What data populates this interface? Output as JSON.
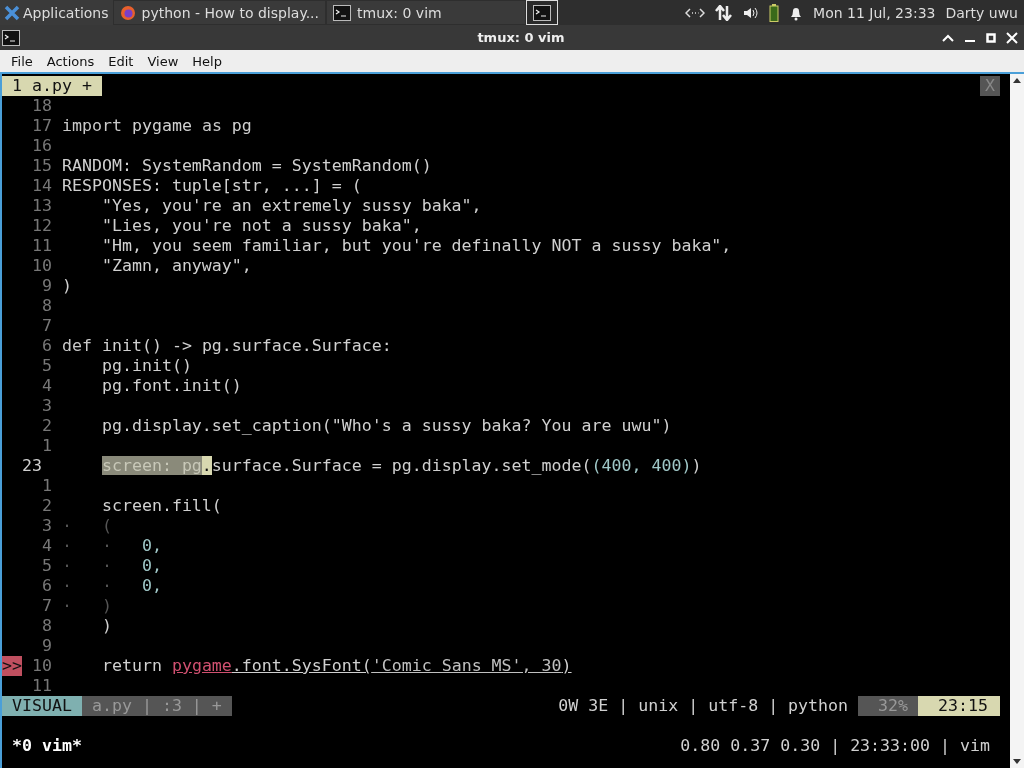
{
  "panel": {
    "menu_label": "Applications",
    "windows": [
      {
        "label": "python - How to display...",
        "kind": "browser",
        "selected": false
      },
      {
        "label": "tmux: 0 vim",
        "kind": "terminal",
        "selected": false
      },
      {
        "kind": "terminal",
        "selected": true
      }
    ],
    "clock": "Mon 11 Jul, 23:33",
    "user": "Darty uwu"
  },
  "window": {
    "title": "tmux: 0 vim"
  },
  "menu": [
    "File",
    "Actions",
    "Edit",
    "View",
    "Help"
  ],
  "vim": {
    "tabline": {
      "tab": "1 a.py +",
      "close": "X"
    },
    "lines": [
      {
        "num": "18"
      },
      {
        "num": "17",
        "segs": [
          {
            "t": "import",
            "kind": "keyword"
          },
          {
            "t": " pygame ",
            "kind": "plain"
          },
          {
            "t": "as",
            "kind": "keyword"
          },
          {
            "t": " pg",
            "kind": "plain"
          }
        ]
      },
      {
        "num": "16"
      },
      {
        "num": "15",
        "segs": [
          {
            "t": "RANDOM: SystemRandom = SystemRandom()",
            "kind": "plain"
          }
        ]
      },
      {
        "num": "14",
        "segs": [
          {
            "t": "RESPONSES: tuple[str, ...] = (",
            "kind": "plain"
          }
        ]
      },
      {
        "num": "13",
        "segs": [
          {
            "t": "    \"Yes, you're an extremely sussy baka\",",
            "kind": "plain"
          }
        ]
      },
      {
        "num": "12",
        "segs": [
          {
            "t": "    \"Lies, you're not a sussy baka\",",
            "kind": "plain"
          }
        ]
      },
      {
        "num": "11",
        "segs": [
          {
            "t": "    \"Hm, you seem familiar, but you're definally NOT a sussy baka\",",
            "kind": "plain"
          }
        ]
      },
      {
        "num": "10",
        "segs": [
          {
            "t": "    \"Zamn, anyway\",",
            "kind": "plain"
          }
        ]
      },
      {
        "num": "9",
        "segs": [
          {
            "t": ")",
            "kind": "plain"
          }
        ]
      },
      {
        "num": "8"
      },
      {
        "num": "7"
      },
      {
        "num": "6",
        "segs": [
          {
            "t": "def",
            "kind": "keyword"
          },
          {
            "t": " init() -> pg.surface.Surface:",
            "kind": "plain"
          }
        ]
      },
      {
        "num": "5",
        "segs": [
          {
            "t": "    pg.init()",
            "kind": "plain"
          }
        ]
      },
      {
        "num": "4",
        "segs": [
          {
            "t": "    pg.font.init()",
            "kind": "plain"
          }
        ]
      },
      {
        "num": "3"
      },
      {
        "num": "2",
        "segs": [
          {
            "t": "    pg.display.set_caption(\"Who's a sussy baka? You are uwu\")",
            "kind": "plain"
          }
        ]
      },
      {
        "num": "1"
      },
      {
        "num": "23",
        "current": true,
        "indented": true,
        "segs": [
          {
            "t": "screen: pg",
            "kind": "visual"
          },
          {
            "t": ".",
            "kind": "cursor"
          },
          {
            "t": "surface.Surface = pg.display.set_mode(",
            "kind": "plain"
          },
          {
            "t": "(400, 400)",
            "kind": "number"
          },
          {
            "t": ")",
            "kind": "plain"
          }
        ]
      },
      {
        "num": "1"
      },
      {
        "num": "2",
        "segs": [
          {
            "t": "    screen.fill(",
            "kind": "plain"
          }
        ]
      },
      {
        "num": "3",
        "segs": [
          {
            "t": "·   (",
            "kind": "dim"
          }
        ]
      },
      {
        "num": "4",
        "segs": [
          {
            "t": "·   ·   ",
            "kind": "dim"
          },
          {
            "t": "0,",
            "kind": "number"
          }
        ]
      },
      {
        "num": "5",
        "segs": [
          {
            "t": "·   ·   ",
            "kind": "dim"
          },
          {
            "t": "0,",
            "kind": "number"
          }
        ]
      },
      {
        "num": "6",
        "segs": [
          {
            "t": "·   ·   ",
            "kind": "dim"
          },
          {
            "t": "0,",
            "kind": "number"
          }
        ]
      },
      {
        "num": "7",
        "segs": [
          {
            "t": "·   )",
            "kind": "dim"
          }
        ]
      },
      {
        "num": "8",
        "segs": [
          {
            "t": "    )",
            "kind": "plain"
          }
        ]
      },
      {
        "num": "9"
      },
      {
        "num": "10",
        "sign": ">>",
        "segs": [
          {
            "t": "    return ",
            "kind": "plain"
          },
          {
            "t": "pygame",
            "kind": "error"
          },
          {
            "t": ".font.SysFont(",
            "kind": "underline"
          },
          {
            "t": "'Comic Sans MS', 30",
            "kind": "underline-dim"
          },
          {
            "t": ")",
            "kind": "underline"
          }
        ]
      },
      {
        "num": "11"
      }
    ],
    "statusline": {
      "mode": "VISUAL",
      "file": "a.py | :3 | +",
      "info": "0W 3E | unix | utf-8 | python",
      "percent": "32%",
      "position": "23:15"
    }
  },
  "tmux": {
    "session": "*0 vim*",
    "status": "0.80 0.37 0.30 | 23:33:00 | vim"
  }
}
